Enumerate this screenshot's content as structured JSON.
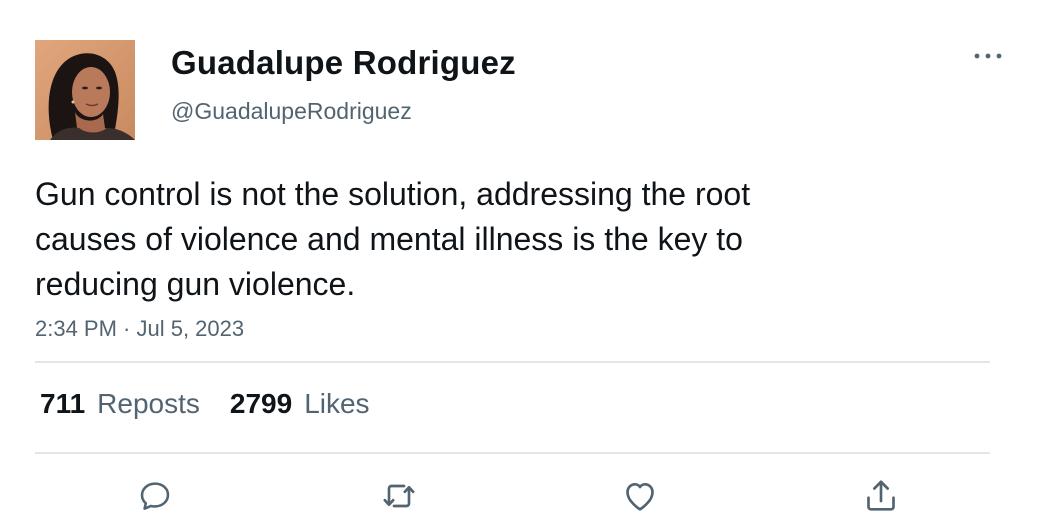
{
  "author": {
    "display_name": "Guadalupe Rodriguez",
    "handle": "@GuadalupeRodriguez"
  },
  "tweet": {
    "text": "Gun control is not the solution, addressing the root\ncauses of violence and mental illness is the key to\nreducing gun violence.",
    "timestamp": "2:34 PM · Jul 5, 2023"
  },
  "stats": {
    "reposts_count": "711",
    "reposts_label": "Reposts",
    "likes_count": "2799",
    "likes_label": "Likes"
  },
  "icons": {
    "more": "more-horizontal-icon",
    "reply": "reply-icon",
    "repost": "repost-icon",
    "like": "heart-icon",
    "share": "share-icon"
  },
  "colors": {
    "text_primary": "#0f1419",
    "text_secondary": "#536471",
    "divider": "#e1e6ea"
  }
}
